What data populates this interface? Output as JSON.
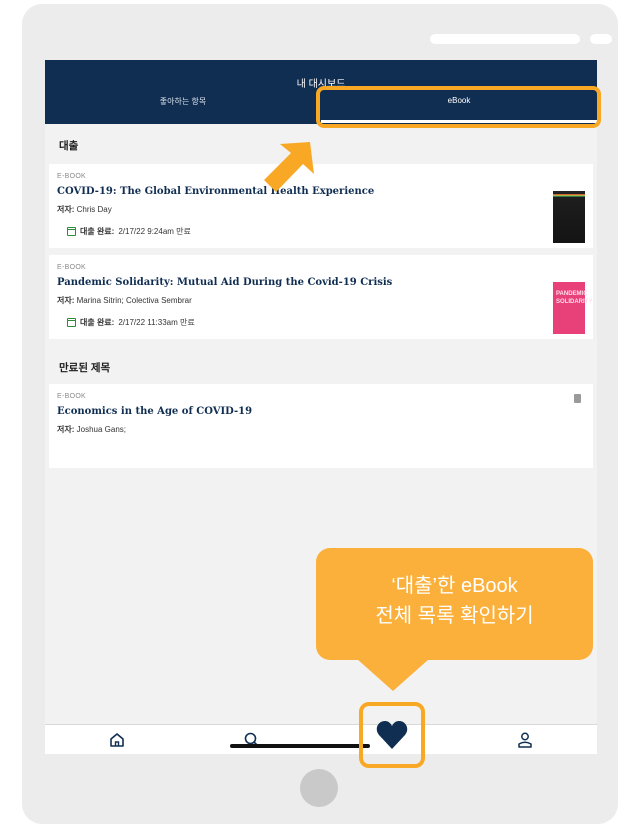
{
  "header": {
    "title": "내 대시보드",
    "tab_favorites": "좋아하는 항목",
    "tab_ebook": "eBook"
  },
  "sections": {
    "loans_title": "대출",
    "expired_title": "만료된 제목"
  },
  "loans": [
    {
      "type": "E-BOOK",
      "title": "COVID-19: The Global Environmental Health Experience",
      "author_label": "저자:",
      "author": "Chris Day",
      "status_label": "대출 완료:",
      "status_value": "2/17/22 9:24am 만료"
    },
    {
      "type": "E-BOOK",
      "title": "Pandemic Solidarity: Mutual Aid During the Covid-19 Crisis",
      "author_label": "저자:",
      "author": "Marina Sitrin; Colectiva Sembrar",
      "status_label": "대출 완료:",
      "status_value": "2/17/22 11:33am 만료",
      "cover_text": "PANDEMIC SOLIDARITY"
    }
  ],
  "expired": [
    {
      "type": "E-BOOK",
      "title": "Economics in the Age of COVID-19",
      "author_label": "저자:",
      "author": "Joshua Gans;"
    }
  ],
  "tooltip": {
    "line1": "‘대출’한 eBook",
    "line2": "전체 목록 확인하기"
  },
  "nav": {
    "items": [
      "home-icon",
      "search-icon",
      "heart-icon",
      "profile-icon"
    ],
    "active": "heart-icon"
  },
  "colors": {
    "header_bg": "#102e52",
    "accent_highlight": "#f9a825",
    "tooltip_bg": "#fbb03b",
    "title_text": "#102e52",
    "loan_icon": "#2e8b3a"
  }
}
